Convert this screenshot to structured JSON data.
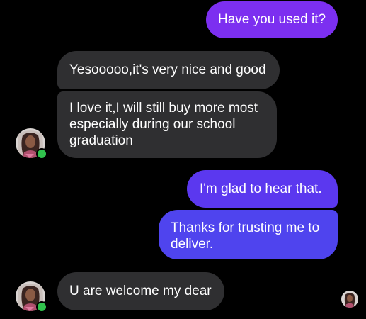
{
  "messages": [
    {
      "id": "m1",
      "direction": "outgoing",
      "text": "Have you used it?"
    },
    {
      "id": "m2",
      "direction": "incoming",
      "text": "Yesooooo,it's very nice and good"
    },
    {
      "id": "m3",
      "direction": "incoming",
      "text": "I love it,I will still buy more most\nespecially during our school\ngraduation"
    },
    {
      "id": "m4",
      "direction": "outgoing",
      "text": "I'm glad to hear that."
    },
    {
      "id": "m5",
      "direction": "outgoing",
      "text": "Thanks for trusting me to\ndeliver."
    },
    {
      "id": "m6",
      "direction": "incoming",
      "text": "U are welcome my dear"
    }
  ],
  "contact": {
    "status": "online",
    "status_color": "#31c24d"
  },
  "colors": {
    "background": "#000000",
    "incoming_bubble": "#2f2f31",
    "outgoing_gradient_top": "#7c2ff0",
    "outgoing_gradient_bottom": "#4f44ee"
  },
  "icons": {
    "contact_avatar": "contact-avatar-photo",
    "seen_indicator": "seen-avatar-photo"
  }
}
